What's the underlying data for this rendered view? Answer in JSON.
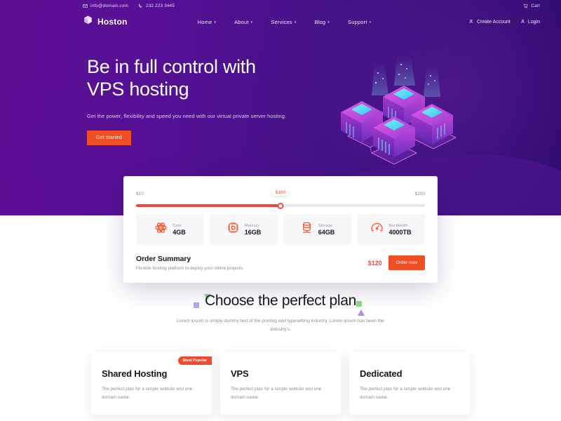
{
  "topbar": {
    "email": "info@domain.com",
    "phone": "232 223 3445",
    "cart_label": "Cart",
    "email_icon": "mail-icon",
    "phone_icon": "phone-icon",
    "cart_icon": "cart-icon"
  },
  "nav": {
    "brand": "Hoston",
    "brand_icon": "cube-logo-icon",
    "links": [
      {
        "label": "Home",
        "caret": "▾"
      },
      {
        "label": "About",
        "caret": "▾"
      },
      {
        "label": "Services",
        "caret": "▾"
      },
      {
        "label": "Blog",
        "caret": "▾"
      },
      {
        "label": "Support",
        "caret": "▾"
      }
    ],
    "create_account": "Create Account",
    "login": "Login",
    "user_icon": "user-icon"
  },
  "hero": {
    "title_line1": "Be in full control with",
    "title_line2": "VPS hosting",
    "subtitle": "Get the power, flexibility and speed you need with our virtual private server hosting.",
    "cta": "Get started",
    "illustration": "isometric-server-cubes-illustration"
  },
  "config": {
    "slider": {
      "min_label": "$10",
      "current_label": "$100",
      "max_label": "$200",
      "min": 10,
      "current": 100,
      "max": 200,
      "percent": 50
    },
    "specs": [
      {
        "icon": "atom-core-icon",
        "label": "Core",
        "value": "4GB"
      },
      {
        "icon": "cpu-chip-icon",
        "label": "Memory",
        "value": "16GB"
      },
      {
        "icon": "database-icon",
        "label": "Storage",
        "value": "64GB"
      },
      {
        "icon": "speed-gauge-icon",
        "label": "Bandwidth",
        "value": "4000TB"
      }
    ],
    "summary_title": "Order Summary",
    "summary_sub": "Flexible hosting platform to deploy your online projects.",
    "price": "$120",
    "order_button": "Order now"
  },
  "plans": {
    "heading": "Choose the perfect plan",
    "description": "Lorem ipsum is simply dummy text of the printing and typesetting industry. Lorem ipsum has been the industry's.",
    "cards": [
      {
        "name": "Shared Hosting",
        "desc": "The perfect plan for a simple website and one domain name.",
        "badge": "Most Popular"
      },
      {
        "name": "VPS",
        "desc": "The perfect plan for a simple website and one domain name.",
        "badge": ""
      },
      {
        "name": "Dedicated",
        "desc": "The perfect plan for a simple website and one domain name.",
        "badge": ""
      }
    ]
  },
  "colors": {
    "purple_dark": "#2d0a6e",
    "purple_light": "#5d0f93",
    "accent_orange": "#f04e23",
    "accent_red": "#f14a44",
    "badge_red": "#f3492f",
    "cyan": "#4fe3f0"
  }
}
